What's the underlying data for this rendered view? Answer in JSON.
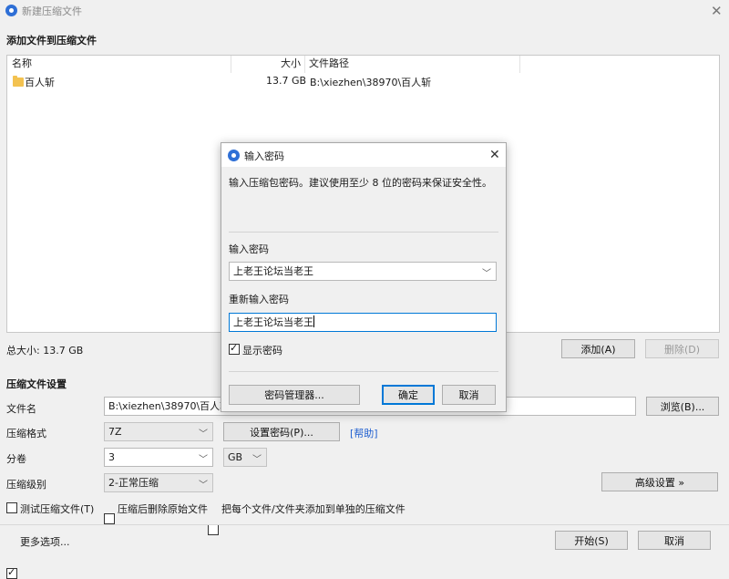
{
  "window": {
    "title": "新建压缩文件",
    "close_glyph": "✕"
  },
  "section_add": {
    "title": "添加文件到压缩文件"
  },
  "file_list": {
    "columns": [
      "名称",
      "大小",
      "文件路径"
    ],
    "rows": [
      {
        "name": "百人斩",
        "size": "13.7 GB",
        "path": "B:\\xiezhen\\38970\\百人斩"
      }
    ]
  },
  "summary": {
    "total_size": "总大小: 13.7 GB",
    "add_label": "添加(A)",
    "delete_label": "删除(D)"
  },
  "settings": {
    "title": "压缩文件设置",
    "filename_label": "文件名",
    "filename_value": "B:\\xiezhen\\38970\\百人斩.7z",
    "browse_label": "浏览(B)...",
    "format_label": "压缩格式",
    "format_value": "7Z",
    "set_password_label": "设置密码(P)...",
    "help_label": "[帮助]",
    "volume_label": "分卷",
    "volume_value": "3",
    "volume_unit": "GB",
    "level_label": "压缩级别",
    "level_value": "2-正常压缩",
    "advanced_label": "高级设置 »",
    "opt_test": "测试压缩文件(T)",
    "opt_delete": "压缩后删除原始文件",
    "opt_separate": "把每个文件/文件夹添加到单独的压缩文件",
    "more_options": "更多选项...",
    "start_label": "开始(S)",
    "cancel_label": "取消"
  },
  "dialog": {
    "title": "输入密码",
    "close_glyph": "✕",
    "hint": "输入压缩包密码。建议使用至少 8 位的密码来保证安全性。",
    "password_label": "输入密码",
    "password_value": "上老王论坛当老王",
    "repeat_label": "重新输入密码",
    "repeat_value": "上老王论坛当老王",
    "show_password": "显示密码",
    "manager_label": "密码管理器...",
    "ok_label": "确定",
    "cancel_label": "取消"
  },
  "colors": {
    "accent": "#0078d7",
    "link": "#1f5fd0",
    "folder": "#f3c250"
  }
}
